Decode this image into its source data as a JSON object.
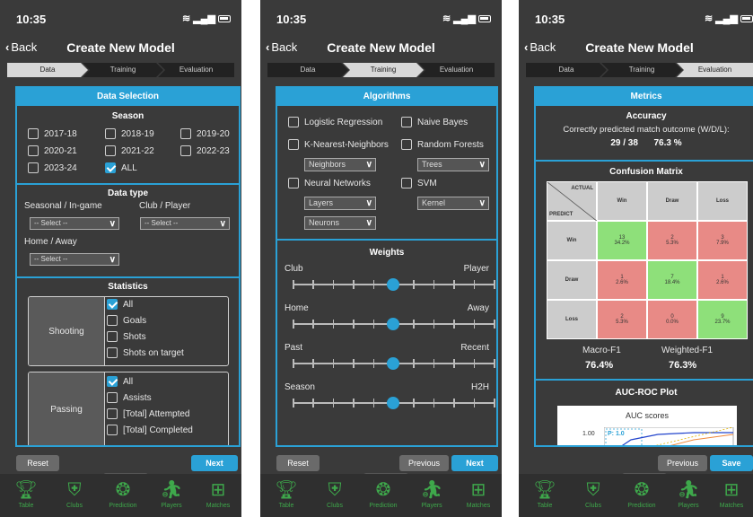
{
  "status": {
    "time": "10:35"
  },
  "nav": {
    "back": "Back",
    "title": "Create New Model"
  },
  "steps": [
    "Data",
    "Training",
    "Evaluation"
  ],
  "tabs": [
    "Table",
    "Clubs",
    "Prediction",
    "Players",
    "Matches"
  ],
  "colors": {
    "accent": "#2aa1d6",
    "tab_green": "#3ea84b",
    "cm_green": "#8ee07a",
    "cm_red": "#e88a86",
    "cm_grey": "#cccccc"
  },
  "screen1": {
    "header": "Data Selection",
    "season_title": "Season",
    "seasons": [
      {
        "label": "2017-18",
        "checked": false
      },
      {
        "label": "2018-19",
        "checked": false
      },
      {
        "label": "2019-20",
        "checked": false
      },
      {
        "label": "2020-21",
        "checked": false
      },
      {
        "label": "2021-22",
        "checked": false
      },
      {
        "label": "2022-23",
        "checked": false
      },
      {
        "label": "2023-24",
        "checked": false
      },
      {
        "label": "ALL",
        "checked": true
      }
    ],
    "datatype_title": "Data type",
    "seasonal_label": "Seasonal / In-game",
    "club_label": "Club / Player",
    "home_label": "Home / Away",
    "select_placeholder": "-- Select --",
    "stats_title": "Statistics",
    "shooting": {
      "label": "Shooting",
      "items": [
        {
          "label": "All",
          "checked": true
        },
        {
          "label": "Goals",
          "checked": false
        },
        {
          "label": "Shots",
          "checked": false
        },
        {
          "label": "Shots on target",
          "checked": false
        }
      ]
    },
    "passing": {
      "label": "Passing",
      "items": [
        {
          "label": "All",
          "checked": true
        },
        {
          "label": "Assists",
          "checked": false
        },
        {
          "label": "[Total] Attempted",
          "checked": false
        },
        {
          "label": "[Total] Completed",
          "checked": false
        }
      ]
    },
    "reset": "Reset",
    "next": "Next"
  },
  "screen2": {
    "header": "Algorithms",
    "algos": [
      {
        "label": "Logistic Regression",
        "checked": false
      },
      {
        "label": "Naive Bayes",
        "checked": false
      },
      {
        "label": "K-Nearest-Neighbors",
        "checked": false
      },
      {
        "label": "Random Forests",
        "checked": false
      },
      {
        "label": "Neural Networks",
        "checked": false
      },
      {
        "label": "SVM",
        "checked": false
      }
    ],
    "neighbors": "Neighbors",
    "trees": "Trees",
    "layers": "Layers",
    "kernel": "Kernel",
    "neurons": "Neurons",
    "weights_title": "Weights",
    "weights": [
      {
        "left": "Club",
        "right": "Player",
        "value": 0.5
      },
      {
        "left": "Home",
        "right": "Away",
        "value": 0.5
      },
      {
        "left": "Past",
        "right": "Recent",
        "value": 0.5
      },
      {
        "left": "Season",
        "right": "H2H",
        "value": 0.5
      }
    ],
    "reset": "Reset",
    "previous": "Previous",
    "next": "Next"
  },
  "screen3": {
    "header": "Metrics",
    "accuracy_title": "Accuracy",
    "accuracy_desc": "Correctly predicted match outcome (W/D/L):",
    "accuracy_count": "29 / 38",
    "accuracy_pct": "76.3 %",
    "cm_title": "Confusion Matrix",
    "cm_actual": "ACTUAL",
    "cm_predict": "PREDICT",
    "cm_cols": [
      "Win",
      "Draw",
      "Loss"
    ],
    "cm_rows": [
      {
        "label": "Win",
        "cells": [
          [
            "13",
            "34.2%"
          ],
          [
            "2",
            "5.3%"
          ],
          [
            "3",
            "7.9%"
          ]
        ]
      },
      {
        "label": "Draw",
        "cells": [
          [
            "1",
            "2.6%"
          ],
          [
            "7",
            "18.4%"
          ],
          [
            "1",
            "2.6%"
          ]
        ]
      },
      {
        "label": "Loss",
        "cells": [
          [
            "2",
            "5.3%"
          ],
          [
            "0",
            "0.0%"
          ],
          [
            "9",
            "23.7%"
          ]
        ]
      }
    ],
    "macro_label": "Macro-F1",
    "macro_value": "76.4%",
    "weighted_label": "Weighted-F1",
    "weighted_value": "76.3%",
    "roc_title": "AUC-ROC Plot",
    "roc_chart_title": "AUC scores",
    "roc_tick": "1.00",
    "roc_legend": "P: 1.0",
    "previous": "Previous",
    "save": "Save"
  }
}
